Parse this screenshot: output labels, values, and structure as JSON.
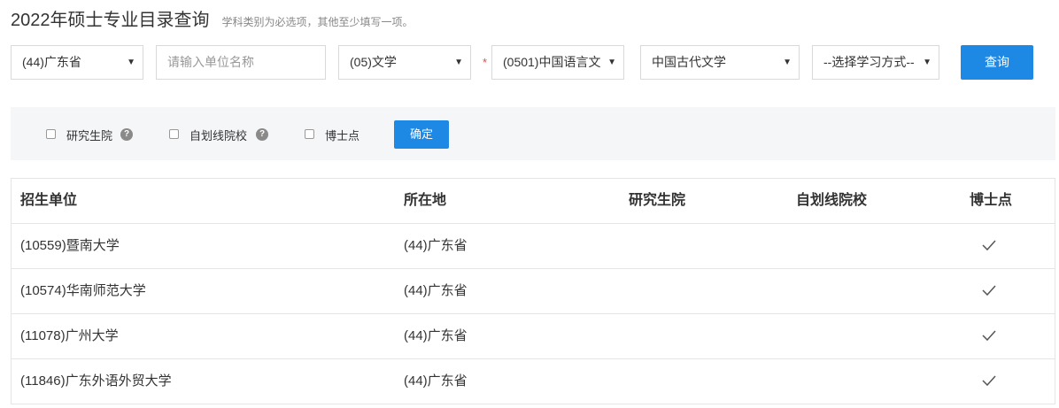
{
  "header": {
    "title": "2022年硕士专业目录查询",
    "hint": "学科类别为必选项，其他至少填写一项。"
  },
  "search": {
    "province": "(44)广东省",
    "unit_placeholder": "请输入单位名称",
    "category": "(05)文学",
    "discipline": "(0501)中国语言文",
    "major": "中国古代文学",
    "study_mode": "--选择学习方式--",
    "query_label": "查询"
  },
  "filters": {
    "graduate_school": "研究生院",
    "self_line": "自划线院校",
    "doctoral": "博士点",
    "confirm_label": "确定"
  },
  "table": {
    "headers": [
      "招生单位",
      "所在地",
      "研究生院",
      "自划线院校",
      "博士点"
    ],
    "rows": [
      {
        "unit": "(10559)暨南大学",
        "location": "(44)广东省",
        "graduate_school": "",
        "self_line": "",
        "doctoral": true
      },
      {
        "unit": "(10574)华南师范大学",
        "location": "(44)广东省",
        "graduate_school": "",
        "self_line": "",
        "doctoral": true
      },
      {
        "unit": "(11078)广州大学",
        "location": "(44)广东省",
        "graduate_school": "",
        "self_line": "",
        "doctoral": true
      },
      {
        "unit": "(11846)广东外语外贸大学",
        "location": "(44)广东省",
        "graduate_school": "",
        "self_line": "",
        "doctoral": true
      }
    ]
  }
}
